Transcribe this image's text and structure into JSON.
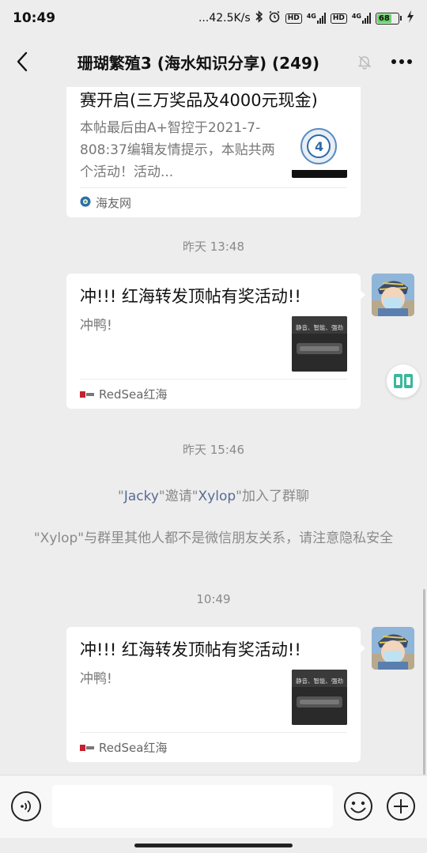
{
  "status": {
    "time": "10:49",
    "net_speed": "...42.5K/s",
    "hd1": "HD",
    "hd2": "HD",
    "g1": "4G",
    "g2": "4G",
    "battery": "68"
  },
  "header": {
    "title": "珊瑚繁殖3 (海水知识分享) (249)"
  },
  "messages": [
    {
      "title": "赛开启(三万奖品及4000元现金)",
      "desc": "本帖最后由A+智控于2021-7-808:37编辑友情提示，本贴共两个活动！活动...",
      "source": "海友网"
    },
    {
      "time": "昨天 13:48",
      "title": "冲!!! 红海转发顶帖有奖活动!!",
      "desc": "冲鸭!",
      "source": "RedSea红海",
      "thumb_text": "静音、智能、强劲"
    },
    {
      "time": "昨天 15:46"
    },
    {
      "system1": {
        "q1": "\"",
        "name1": "Jacky",
        "mid": "\"邀请\"",
        "name2": "Xylop",
        "end": "\"加入了群聊"
      },
      "system2": "\"Xylop\"与群里其他人都不是微信朋友关系，请注意隐私安全"
    },
    {
      "time": "10:49",
      "title": "冲!!! 红海转发顶帖有奖活动!!",
      "desc": "冲鸭!",
      "source": "RedSea红海",
      "thumb_text": "静音、智能、强劲"
    }
  ],
  "colors": {
    "background": "#ededed",
    "link_blue": "#576b95",
    "battery_green": "#6ad16a"
  }
}
